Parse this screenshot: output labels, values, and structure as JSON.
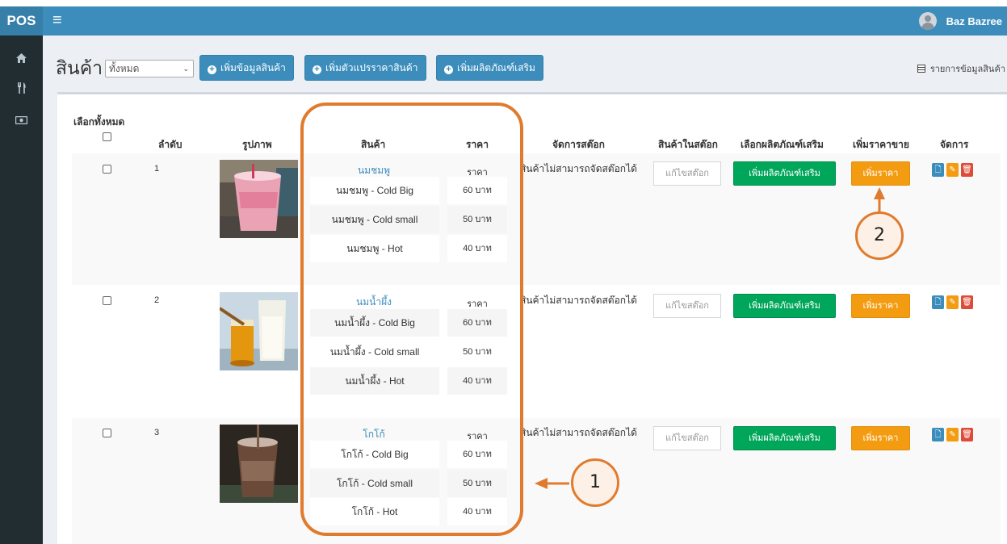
{
  "topbar": {
    "logo": "POS",
    "menu_icon": "hamburger-icon",
    "user_name": "Baz Bazree"
  },
  "sidebar": {
    "items": [
      {
        "icon": "home-icon",
        "glyph": "🏠"
      },
      {
        "icon": "cutlery-icon",
        "glyph": "🍴"
      },
      {
        "icon": "money-icon",
        "glyph": "💵"
      }
    ]
  },
  "page": {
    "title": "สินค้า",
    "filter_value": "ทั้งหมด",
    "buttons": {
      "add_product": "เพิ่มข้อมูลสินค้า",
      "add_price_variant": "เพิ่มตัวแปรราคาสินค้า",
      "add_addon": "เพิ่มผลิตภัณฑ์เสริม"
    },
    "right_link": "รายการข้อมูลสินค้า"
  },
  "table": {
    "headers": {
      "select_all": "เลือกทั้งหมด",
      "order": "ลำดับ",
      "image": "รูปภาพ",
      "product": "สินค้า",
      "price": "ราคา",
      "manage_stock": "จัดการสต๊อก",
      "in_stock": "สินค้าในสต๊อก",
      "select_addon": "เลือกผลิตภัณฑ์เสริม",
      "add_price": "เพิ่มราคาขาย",
      "actions": "จัดการ"
    },
    "rows": [
      {
        "order": "1",
        "name": "นมชมพู",
        "price_label": "ราคา",
        "variants": [
          {
            "name": "นมชมพู - Cold Big",
            "price": "60 บาท"
          },
          {
            "name": "นมชมพู - Cold small",
            "price": "50 บาท"
          },
          {
            "name": "นมชมพู - Hot",
            "price": "40 บาท"
          }
        ],
        "stock_note": "สินค้าไม่สามารถจัดสต๊อกได้",
        "stock_input": "แก้ไขสต๊อก",
        "addon_button": "เพิ่มผลิตภัณฑ์เสริม",
        "price_button": "เพิ่มราคา"
      },
      {
        "order": "2",
        "name": "นมน้ำผึ้ง",
        "price_label": "ราคา",
        "variants": [
          {
            "name": "นมน้ำผึ้ง - Cold Big",
            "price": "60 บาท"
          },
          {
            "name": "นมน้ำผึ้ง - Cold small",
            "price": "50 บาท"
          },
          {
            "name": "นมน้ำผึ้ง - Hot",
            "price": "40 บาท"
          }
        ],
        "stock_note": "สินค้าไม่สามารถจัดสต๊อกได้",
        "stock_input": "แก้ไขสต๊อก",
        "addon_button": "เพิ่มผลิตภัณฑ์เสริม",
        "price_button": "เพิ่มราคา"
      },
      {
        "order": "3",
        "name": "โกโก้",
        "price_label": "ราคา",
        "variants": [
          {
            "name": "โกโก้ - Cold Big",
            "price": "60 บาท"
          },
          {
            "name": "โกโก้ - Cold small",
            "price": "50 บาท"
          },
          {
            "name": "โกโก้ - Hot",
            "price": "40 บาท"
          }
        ],
        "stock_note": "สินค้าไม่สามารถจัดสต๊อกได้",
        "stock_input": "แก้ไขสต๊อก",
        "addon_button": "เพิ่มผลิตภัณฑ์เสริม",
        "price_button": "เพิ่มราคา"
      }
    ]
  },
  "annotations": {
    "marker_1": "1",
    "marker_2": "2",
    "color": "#e07b2e"
  }
}
